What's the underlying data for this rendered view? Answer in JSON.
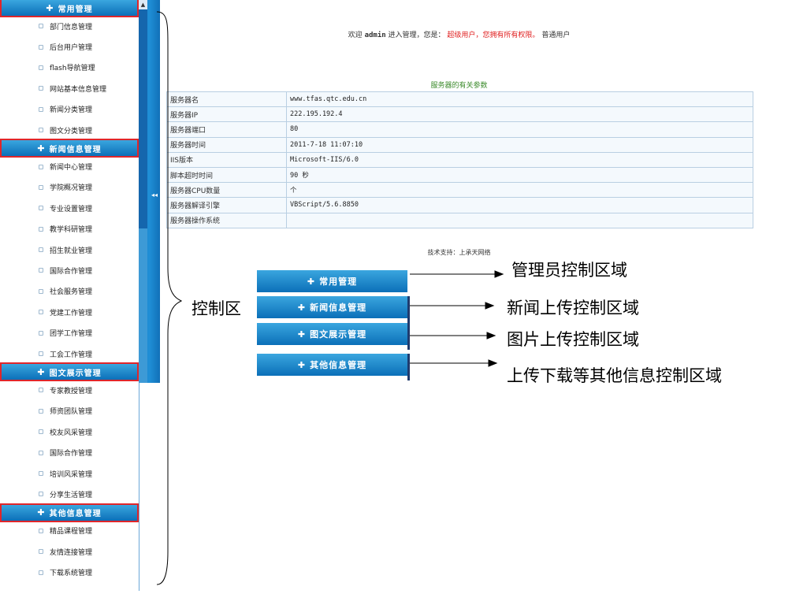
{
  "sidebar": {
    "groups": [
      {
        "title": "常用管理",
        "items": [
          "部门信息管理",
          "后台用户管理",
          "flash导航管理",
          "网站基本信息管理",
          "新闻分类管理",
          "图文分类管理"
        ]
      },
      {
        "title": "新闻信息管理",
        "items": [
          "新闻中心管理",
          "学院概况管理",
          "专业设置管理",
          "教学科研管理",
          "招生就业管理",
          "国际合作管理",
          "社会服务管理",
          "党建工作管理",
          "团学工作管理",
          "工会工作管理"
        ]
      },
      {
        "title": "图文展示管理",
        "items": [
          "专家教授管理",
          "师资团队管理",
          "校友风采管理",
          "国际合作管理",
          "培训风采管理",
          "分享生活管理"
        ]
      },
      {
        "title": "其他信息管理",
        "items": [
          "精品课程管理",
          "友情连接管理",
          "下载系统管理"
        ]
      }
    ]
  },
  "welcome": {
    "prefix": "欢迎",
    "user": "admin",
    "middle": "进入管理，您是：",
    "role": "超级用户，您拥有所有权限。",
    "suffix": "普通用户"
  },
  "server": {
    "title": "服务器的有关参数",
    "rows": [
      {
        "k": "服务器名",
        "v": "www.tfas.qtc.edu.cn"
      },
      {
        "k": "服务器IP",
        "v": "222.195.192.4"
      },
      {
        "k": "服务器端口",
        "v": "80"
      },
      {
        "k": "服务器时间",
        "v": "2011-7-18 11:07:10"
      },
      {
        "k": "IIS版本",
        "v": "Microsoft-IIS/6.0"
      },
      {
        "k": "脚本超时时间",
        "v": "90 秒"
      },
      {
        "k": "服务器CPU数量",
        "v": "个"
      },
      {
        "k": "服务器解译引擎",
        "v": "VBScript/5.6.8850"
      },
      {
        "k": "服务器操作系统",
        "v": ""
      }
    ]
  },
  "support_text": "技术支持：上承天网络",
  "annotations": {
    "control_area": "控制区",
    "buttons": [
      "常用管理",
      "新闻信息管理",
      "图文展示管理",
      "其他信息管理"
    ],
    "callouts": [
      "管理员控制区域",
      "新闻上传控制区域",
      "图片上传控制区域",
      "上传下载等其他信息控制区域"
    ]
  },
  "colors": {
    "highlight_box": "#e0262a",
    "accent_blue": "#1f8fd6"
  }
}
